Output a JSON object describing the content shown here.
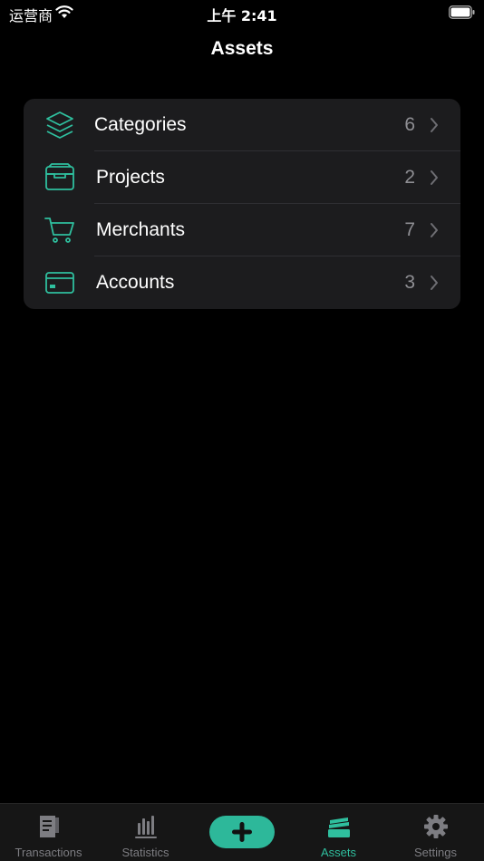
{
  "status_bar": {
    "carrier": "运营商",
    "time": "上午 2:41"
  },
  "nav": {
    "title": "Assets"
  },
  "accent_color": "#2fbf9e",
  "assets": {
    "items": [
      {
        "label": "Categories",
        "count": "6",
        "icon": "layers-icon"
      },
      {
        "label": "Projects",
        "count": "2",
        "icon": "inbox-tray-icon"
      },
      {
        "label": "Merchants",
        "count": "7",
        "icon": "shopping-cart-icon"
      },
      {
        "label": "Accounts",
        "count": "3",
        "icon": "credit-card-icon"
      }
    ]
  },
  "tab_bar": {
    "tabs": [
      {
        "label": "Transactions",
        "icon": "document-icon"
      },
      {
        "label": "Statistics",
        "icon": "bar-chart-icon"
      },
      {
        "label": "",
        "icon": "plus-icon"
      },
      {
        "label": "Assets",
        "icon": "stack-icon"
      },
      {
        "label": "Settings",
        "icon": "gear-icon"
      }
    ],
    "active": "Assets"
  }
}
